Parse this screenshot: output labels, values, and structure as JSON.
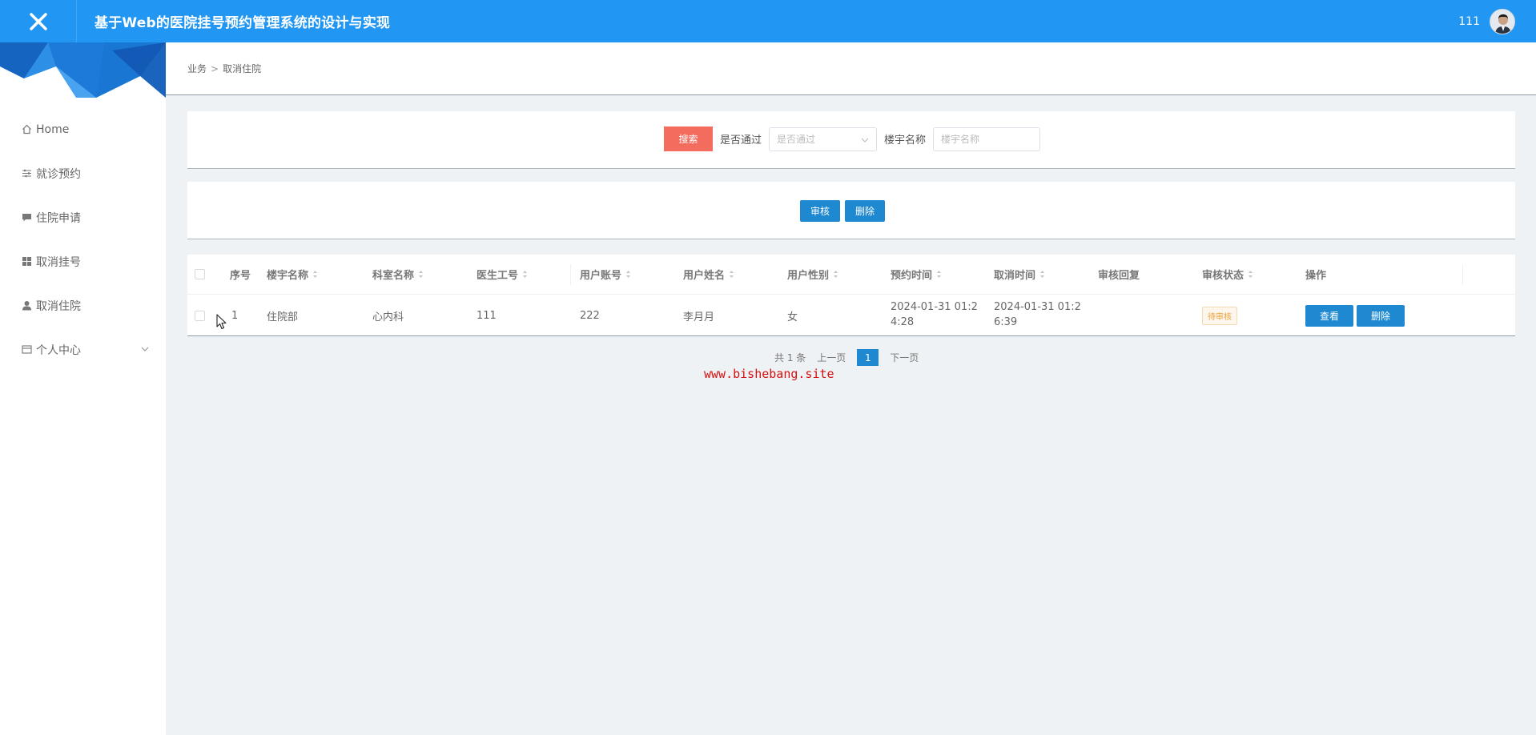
{
  "header": {
    "title": "基于Web的医院挂号预约管理系统的设计与实现",
    "username": "111"
  },
  "sidebar": {
    "items": [
      {
        "label": "Home",
        "icon": "home-icon"
      },
      {
        "label": "就诊预约",
        "icon": "sliders-icon"
      },
      {
        "label": "住院申请",
        "icon": "chat-icon"
      },
      {
        "label": "取消挂号",
        "icon": "grid-icon"
      },
      {
        "label": "取消住院",
        "icon": "user-icon"
      },
      {
        "label": "个人中心",
        "icon": "card-icon",
        "expandable": true
      }
    ]
  },
  "breadcrumb": {
    "parent": "业务",
    "separator": ">",
    "current": "取消住院"
  },
  "search": {
    "button_label": "搜索",
    "approved_label": "是否通过",
    "approved_placeholder": "是否通过",
    "building_label": "楼宇名称",
    "building_placeholder": "楼宇名称"
  },
  "actions": {
    "review_label": "审核",
    "delete_label": "删除"
  },
  "table": {
    "headers": [
      "序号",
      "楼宇名称",
      "科室名称",
      "医生工号",
      "用户账号",
      "用户姓名",
      "用户性别",
      "预约时间",
      "取消时间",
      "审核回复",
      "审核状态",
      "操作"
    ],
    "rows": [
      {
        "index": "1",
        "building": "住院部",
        "department": "心内科",
        "doctor_id": "111",
        "user_account": "222",
        "user_name": "李月月",
        "gender": "女",
        "appointment_time": "2024-01-31 01:24:28",
        "cancel_time": "2024-01-31 01:26:39",
        "review_reply": "",
        "review_status": "待审核",
        "view_label": "查看",
        "delete_label": "删除"
      }
    ]
  },
  "pagination": {
    "total": "共 1 条",
    "prev": "上一页",
    "current_page": "1",
    "next": "下一页"
  },
  "watermark": "www.bishebang.site",
  "colors": {
    "header_bg": "#2196f3",
    "primary_button": "#1e88d0",
    "search_button": "#f46c5e",
    "status_pending": "#e6a23c"
  }
}
